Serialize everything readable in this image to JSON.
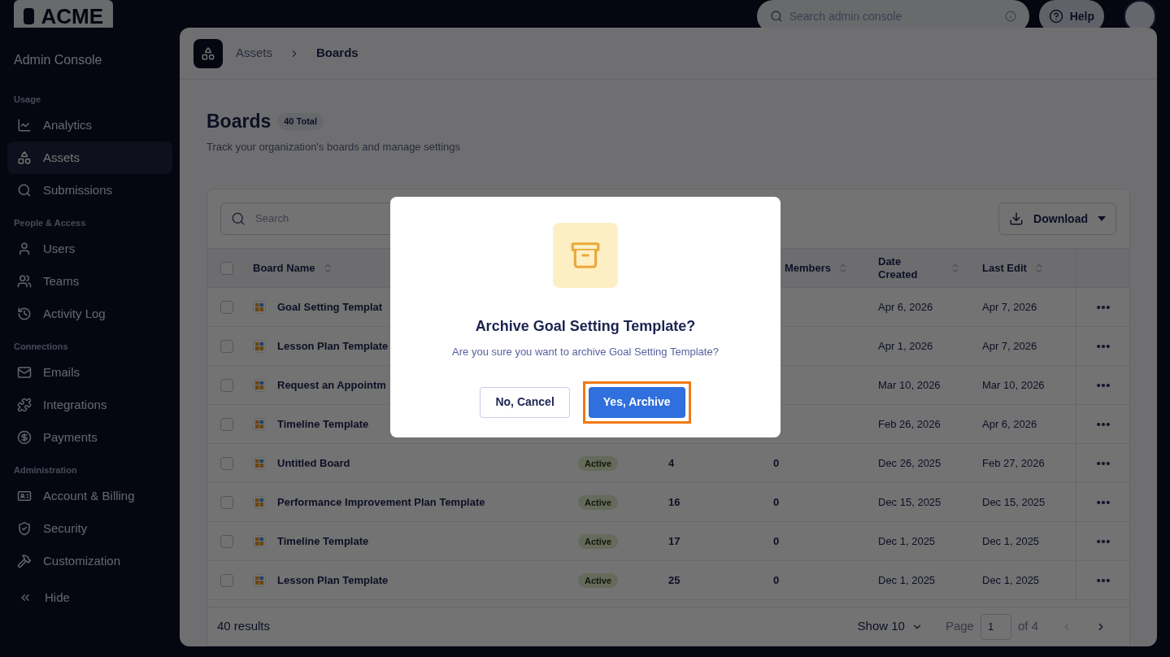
{
  "header": {
    "logo": "ACME",
    "search_placeholder": "Search admin console",
    "help": "Help"
  },
  "sidebar": {
    "title": "Admin Console",
    "sections": [
      {
        "label": "Usage",
        "items": [
          {
            "label": "Analytics",
            "selected": false
          },
          {
            "label": "Assets",
            "selected": true
          },
          {
            "label": "Submissions",
            "selected": false
          }
        ]
      },
      {
        "label": "People & Access",
        "items": [
          {
            "label": "Users",
            "selected": false
          },
          {
            "label": "Teams",
            "selected": false
          },
          {
            "label": "Activity Log",
            "selected": false
          }
        ]
      },
      {
        "label": "Connections",
        "items": [
          {
            "label": "Emails",
            "selected": false
          },
          {
            "label": "Integrations",
            "selected": false
          },
          {
            "label": "Payments",
            "selected": false
          }
        ]
      },
      {
        "label": "Administration",
        "items": [
          {
            "label": "Account & Billing",
            "selected": false
          },
          {
            "label": "Security",
            "selected": false
          },
          {
            "label": "Customization",
            "selected": false
          }
        ]
      }
    ],
    "hide": "Hide"
  },
  "breadcrumb": [
    "Assets",
    "Boards"
  ],
  "page": {
    "title": "Boards",
    "badge": "40 Total",
    "subtitle": "Track your organization's boards and manage settings"
  },
  "toolbar": {
    "search_placeholder": "Search",
    "download": "Download"
  },
  "table": {
    "header_checked": false,
    "columns": [
      "Board Name",
      "Members",
      "Date Created",
      "Last Edit"
    ],
    "rows": [
      {
        "name": "Goal Setting Templat",
        "date_created": "Apr 6, 2026",
        "last_edit": "Apr 7, 2026",
        "checked": false
      },
      {
        "name": "Lesson Plan Template",
        "date_created": "Apr 1, 2026",
        "last_edit": "Apr 7, 2026",
        "checked": false
      },
      {
        "name": "Request an Appointm",
        "date_created": "Mar 10, 2026",
        "last_edit": "Mar 10, 2026",
        "checked": false
      },
      {
        "name": "Timeline Template",
        "date_created": "Feb 26, 2026",
        "last_edit": "Apr 6, 2026",
        "checked": false
      },
      {
        "name": "Untitled Board",
        "status": "Active",
        "count": "4",
        "members": "0",
        "date_created": "Dec 26, 2025",
        "last_edit": "Feb 27, 2026",
        "checked": false
      },
      {
        "name": "Performance Improvement Plan Template",
        "status": "Active",
        "count": "16",
        "members": "0",
        "date_created": "Dec 15, 2025",
        "last_edit": "Dec 15, 2025",
        "checked": false
      },
      {
        "name": "Timeline Template",
        "status": "Active",
        "count": "17",
        "members": "0",
        "date_created": "Dec 1, 2025",
        "last_edit": "Dec 1, 2025",
        "checked": false
      },
      {
        "name": "Lesson Plan Template",
        "status": "Active",
        "count": "25",
        "members": "0",
        "date_created": "Dec 1, 2025",
        "last_edit": "Dec 1, 2025",
        "checked": false
      }
    ]
  },
  "footer": {
    "results": "40 results",
    "show": "Show 10",
    "page_label": "Page",
    "page": "1",
    "of": "of 4",
    "prev_disabled": true
  },
  "dialog": {
    "title": "Archive Goal Setting Template?",
    "message": "Are you sure you want to archive Goal Setting Template?",
    "cancel": "No, Cancel",
    "confirm": "Yes, Archive",
    "confirm_highlighted": true
  }
}
